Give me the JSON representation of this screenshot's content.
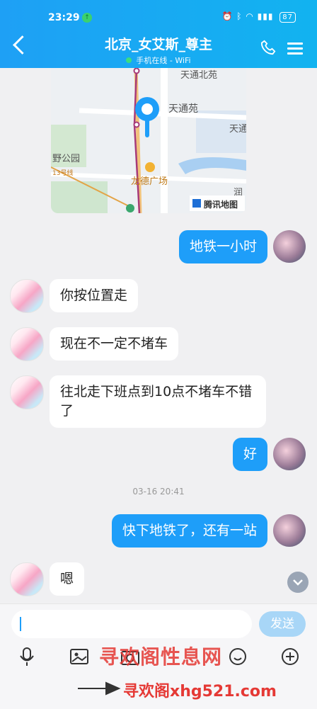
{
  "status_bar": {
    "time": "23:29",
    "battery": "87"
  },
  "header": {
    "title": "北京_女艾斯_尊主",
    "subtitle": "手机在线 - WiFi",
    "accent_color": "#1e9ef9"
  },
  "map": {
    "labels": [
      "天通北苑",
      "天通苑",
      "天通",
      "野公园",
      "13号线",
      "龙德广场",
      "润"
    ],
    "brand": "腾讯地图"
  },
  "messages": [
    {
      "side": "out",
      "text": "地铁一小时"
    },
    {
      "side": "in",
      "text": "你按位置走"
    },
    {
      "side": "in",
      "text": "现在不一定不堵车"
    },
    {
      "side": "in",
      "text": "往北走下班点到10点不堵车不错了"
    },
    {
      "side": "out",
      "text": "好"
    },
    {
      "side": "out",
      "text": "快下地铁了，还有一站"
    },
    {
      "side": "in",
      "text": "嗯"
    }
  ],
  "timestamp": "03-16 20:41",
  "composer": {
    "input_value": "",
    "send_label": "发送"
  },
  "toolbar_icons": [
    "mic-icon",
    "image-icon",
    "camera-icon",
    "emoji-icon",
    "plus-icon"
  ],
  "watermarks": {
    "top": "寻欢阁性息网",
    "bottom": "寻欢阁xhg521.com"
  }
}
